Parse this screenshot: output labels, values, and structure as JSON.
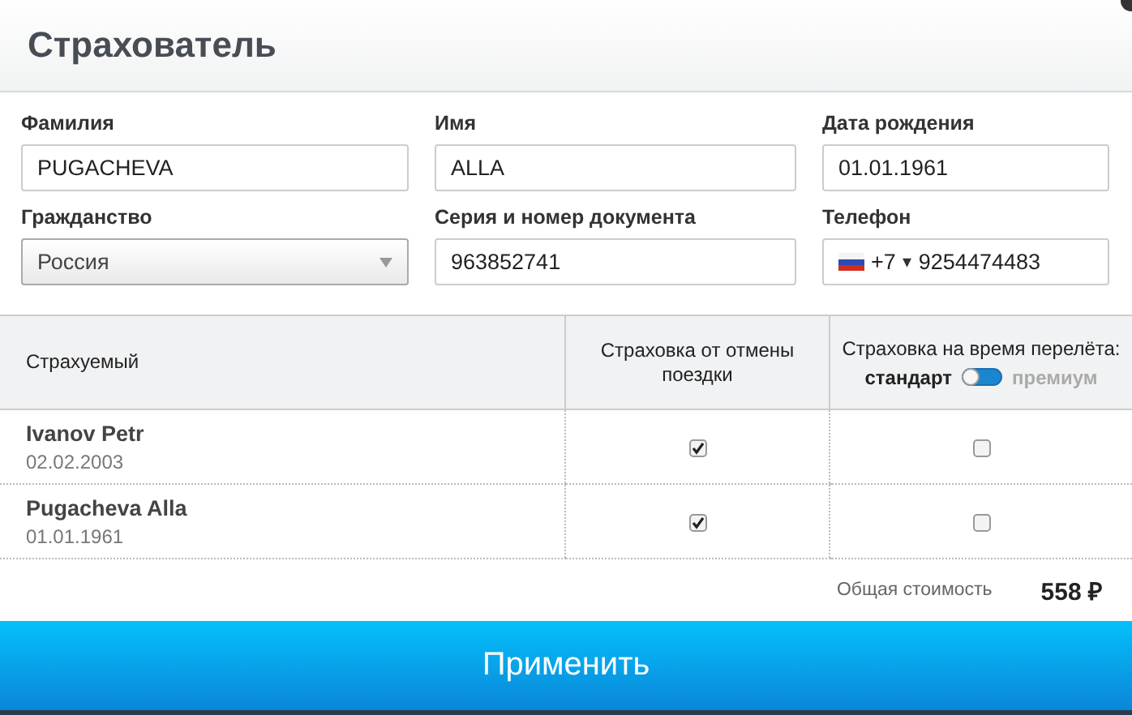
{
  "title": "Страхователь",
  "fields": [
    {
      "kind": "text",
      "label": "Фамилия",
      "value": "PUGACHEVA"
    },
    {
      "kind": "text",
      "label": "Имя",
      "value": "ALLA"
    },
    {
      "kind": "text",
      "label": "Дата рождения",
      "value": "01.01.1961"
    },
    {
      "kind": "select",
      "label": "Гражданство",
      "value": "Россия"
    },
    {
      "kind": "text",
      "label": "Серия и номер документа",
      "value": "963852741"
    },
    {
      "kind": "phone",
      "label": "Телефон",
      "code": "+7",
      "caret": "▾",
      "value": "9254474483"
    }
  ],
  "table": {
    "columns": [
      "Страхуемый",
      "Страховка от отмены поездки",
      "Страховка на время перелёта:"
    ],
    "toggle": {
      "left": "стандарт",
      "right": "премиум",
      "on": false
    },
    "rows": [
      {
        "name": "Ivanov Petr",
        "date": "02.02.2003",
        "cancel": true,
        "flight": false
      },
      {
        "name": "Pugacheva Alla",
        "date": "01.01.1961",
        "cancel": true,
        "flight": false
      }
    ]
  },
  "total": {
    "label": "Общая стоимость",
    "value": "558 ₽"
  },
  "button": "Применить"
}
